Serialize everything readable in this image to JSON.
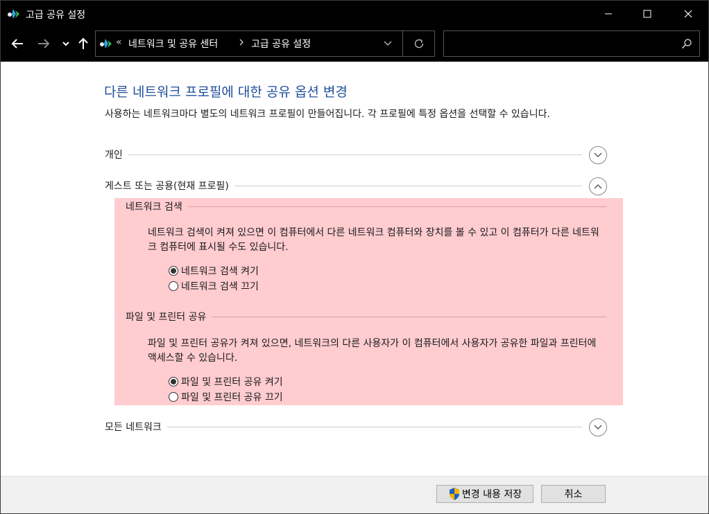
{
  "window": {
    "title": "고급 공유 설정"
  },
  "address": {
    "overflow": "«",
    "crumbs": [
      "네트워크 및 공유 센터",
      "고급 공유 설정"
    ]
  },
  "search": {
    "placeholder": ""
  },
  "page": {
    "title": "다른 네트워크 프로필에 대한 공유 옵션 변경",
    "description": "사용하는 네트워크마다 별도의 네트워크 프로필이 만들어집니다. 각 프로필에 특정 옵션을 선택할 수 있습니다."
  },
  "sections": {
    "private": {
      "label": "개인",
      "expanded": false
    },
    "guest_public": {
      "label": "게스트 또는 공용(현재 프로필)",
      "expanded": true
    },
    "all_networks": {
      "label": "모든 네트워크",
      "expanded": false
    }
  },
  "network_discovery": {
    "heading": "네트워크 검색",
    "description": "네트워크 검색이 켜져 있으면 이 컴퓨터에서 다른 네트워크 컴퓨터와 장치를 볼 수 있고 이 컴퓨터가 다른 네트워크 컴퓨터에 표시될 수도 있습니다.",
    "option_on": "네트워크 검색 켜기",
    "option_off": "네트워크 검색 끄기",
    "selected": "on"
  },
  "file_printer_sharing": {
    "heading": "파일 및 프린터 공유",
    "description": "파일 및 프린터 공유가 켜져 있으면, 네트워크의 다른 사용자가 이 컴퓨터에서 사용자가 공유한 파일과 프린터에 액세스할 수 있습니다.",
    "option_on": "파일 및 프린터 공유 켜기",
    "option_off": "파일 및 프린터 공유 끄기",
    "selected": "on"
  },
  "footer": {
    "save_label": "변경 내용 저장",
    "cancel_label": "취소"
  },
  "colors": {
    "title_blue": "#1e4e9c",
    "highlight_pink": "#ffccd0",
    "titlebar": "#000000"
  }
}
